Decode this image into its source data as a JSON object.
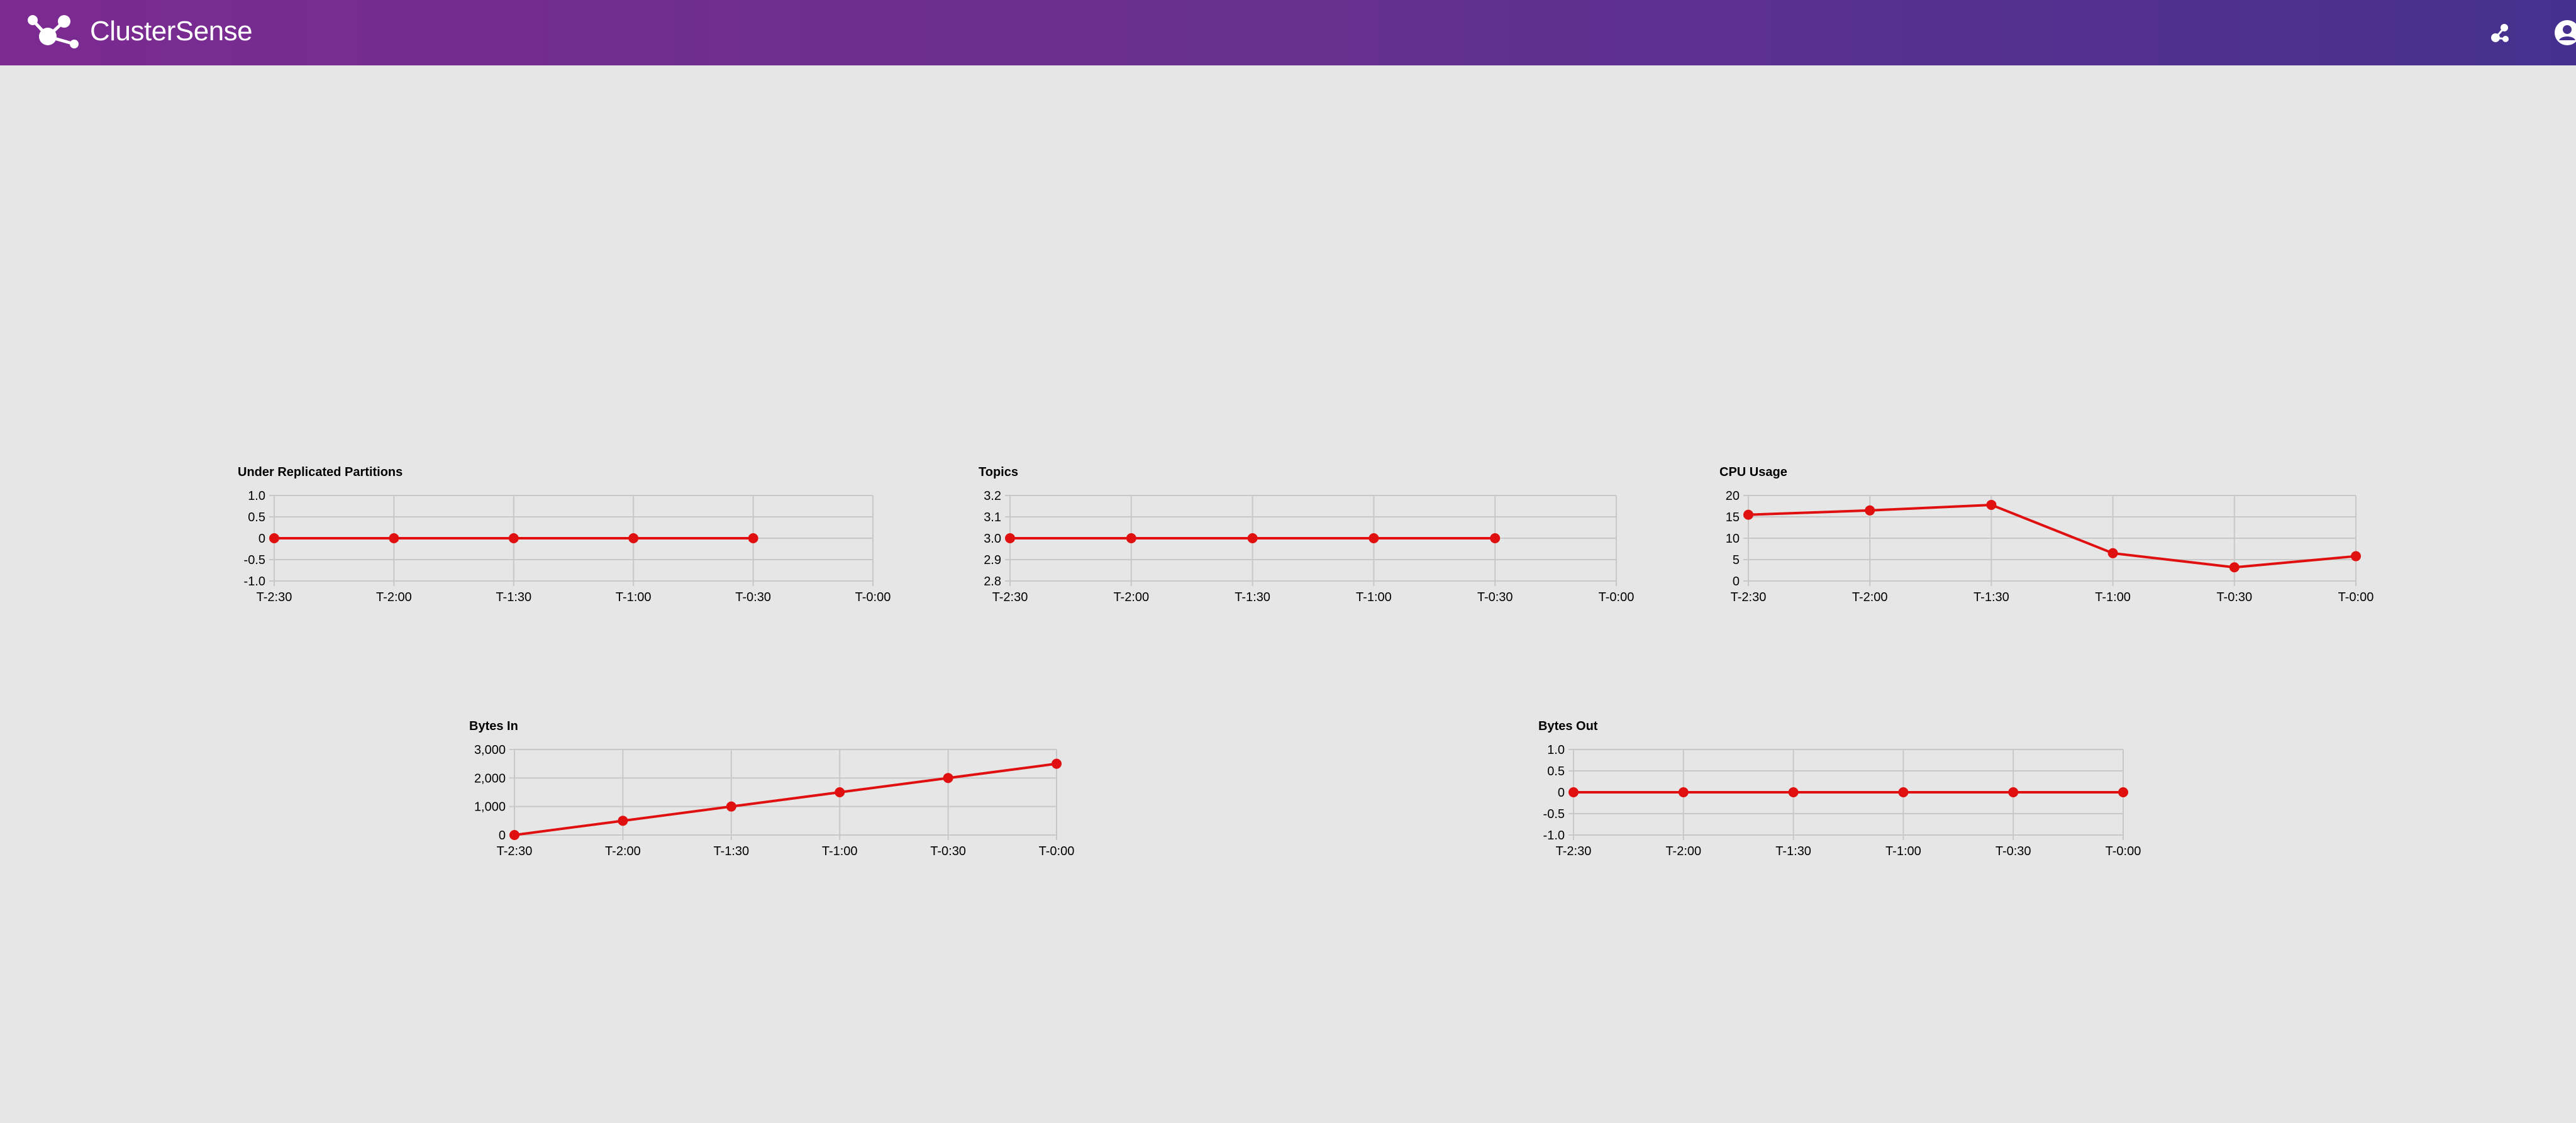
{
  "app": {
    "title": "ClusterSense"
  },
  "header": {
    "icons": [
      "network-icon",
      "account-circle-icon"
    ]
  },
  "colors": {
    "header_start": "#7b2a90",
    "header_end": "#46308f",
    "series": "#e01010",
    "background": "#e6e6e6"
  },
  "chart_data": [
    {
      "type": "line",
      "title": "Under Replicated Partitions",
      "categories": [
        "T-2:30",
        "T-2:00",
        "T-1:30",
        "T-1:00",
        "T-0:30",
        "T-0:00"
      ],
      "values": [
        0,
        0,
        0,
        0,
        0,
        null
      ],
      "yticks": [
        "1.0",
        "0.5",
        "0",
        "-0.5",
        "-1.0"
      ],
      "ylim": [
        -1.0,
        1.0
      ],
      "grid": true
    },
    {
      "type": "line",
      "title": "Topics",
      "categories": [
        "T-2:30",
        "T-2:00",
        "T-1:30",
        "T-1:00",
        "T-0:30",
        "T-0:00"
      ],
      "values": [
        3.0,
        3.0,
        3.0,
        3.0,
        3.0,
        null
      ],
      "yticks": [
        "3.2",
        "3.1",
        "3.0",
        "2.9",
        "2.8"
      ],
      "ylim": [
        2.8,
        3.2
      ],
      "grid": true
    },
    {
      "type": "line",
      "title": "CPU Usage",
      "categories": [
        "T-2:30",
        "T-2:00",
        "T-1:30",
        "T-1:00",
        "T-0:30",
        "T-0:00"
      ],
      "values": [
        15.5,
        16.5,
        17.8,
        6.5,
        3.2,
        5.8
      ],
      "yticks": [
        "20",
        "15",
        "10",
        "5",
        "0"
      ],
      "ylim": [
        0,
        20
      ],
      "grid": true
    },
    {
      "type": "line",
      "title": "Bytes In",
      "categories": [
        "T-2:30",
        "T-2:00",
        "T-1:30",
        "T-1:00",
        "T-0:30",
        "T-0:00"
      ],
      "values": [
        0,
        500,
        1000,
        1500,
        2000,
        2500
      ],
      "yticks": [
        "3,000",
        "2,000",
        "1,000",
        "0"
      ],
      "ylim": [
        0,
        3000
      ],
      "grid": true
    },
    {
      "type": "line",
      "title": "Bytes Out",
      "categories": [
        "T-2:30",
        "T-2:00",
        "T-1:30",
        "T-1:00",
        "T-0:30",
        "T-0:00"
      ],
      "values": [
        0,
        0,
        0,
        0,
        0,
        0
      ],
      "yticks": [
        "1.0",
        "0.5",
        "0",
        "-0.5",
        "-1.0"
      ],
      "ylim": [
        -1.0,
        1.0
      ],
      "grid": true
    }
  ]
}
